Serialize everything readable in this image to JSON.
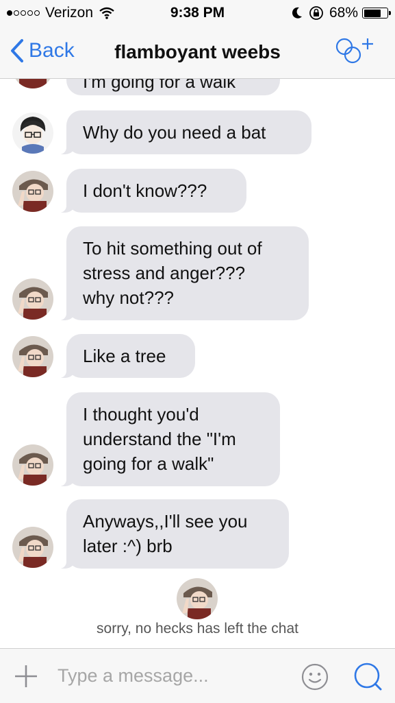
{
  "status_bar": {
    "carrier": "Verizon",
    "time": "9:38 PM",
    "battery": "68%",
    "signal_bars": 1,
    "battery_level": 0.68
  },
  "nav": {
    "back_label": "Back",
    "title": "flamboyant weebs",
    "accent_color": "#2f78e6"
  },
  "messages": [
    {
      "sender": "friend",
      "text": "I'm going for a walk"
    },
    {
      "sender": "other",
      "text": "Why do you need a bat"
    },
    {
      "sender": "friend",
      "text": "I don't know???"
    },
    {
      "sender": "friend",
      "lines": [
        "To hit something out of",
        "stress and anger???",
        "why not???"
      ]
    },
    {
      "sender": "friend",
      "text": "Like a tree"
    },
    {
      "sender": "friend",
      "lines": [
        "I thought you'd",
        "understand the \"I'm",
        "going for a walk\""
      ]
    },
    {
      "sender": "friend",
      "lines": [
        "Anyways,,I'll see you",
        "later :^) brb"
      ]
    }
  ],
  "left_notice": "sorry, no hecks has left the chat",
  "input": {
    "placeholder": "Type a message..."
  },
  "colors": {
    "bubble": "#e5e5ea",
    "bar": "#f7f7f7"
  }
}
